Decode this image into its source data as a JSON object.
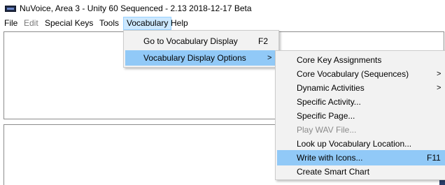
{
  "window": {
    "title": "NuVoice, Area 3 - Unity 60 Sequenced - 2.13 2018-12-17 Beta",
    "icon": "app-icon"
  },
  "menubar": {
    "items": [
      {
        "label": "File",
        "state": "enabled"
      },
      {
        "label": "Edit",
        "state": "disabled"
      },
      {
        "label": "Special Keys",
        "state": "enabled"
      },
      {
        "label": "Tools",
        "state": "enabled"
      },
      {
        "label": "Vocabulary",
        "state": "active"
      },
      {
        "label": "Help",
        "state": "enabled"
      }
    ]
  },
  "vocabulary_menu": {
    "items": [
      {
        "label": "Go to Vocabulary Display",
        "shortcut": "F2"
      },
      {
        "label": "Vocabulary Display Options",
        "submenu_arrow": ">",
        "highlighted": true
      }
    ]
  },
  "display_options_submenu": {
    "items": [
      {
        "label": "Core Key Assignments"
      },
      {
        "label": "Core Vocabulary (Sequences)",
        "submenu_arrow": ">"
      },
      {
        "label": "Dynamic Activities",
        "submenu_arrow": ">"
      },
      {
        "label": "Specific Activity..."
      },
      {
        "label": "Specific Page..."
      },
      {
        "label": "Play WAV File...",
        "disabled": true
      },
      {
        "label": "Look up Vocabulary Location..."
      },
      {
        "label": "Write with Icons...",
        "shortcut": "F11",
        "highlighted": true
      },
      {
        "label": "Create Smart Chart"
      }
    ]
  },
  "colors": {
    "menu_highlight": "#91c9f7",
    "menubar_active": "#cce8ff",
    "dropdown_bg": "#f2f2f2"
  }
}
